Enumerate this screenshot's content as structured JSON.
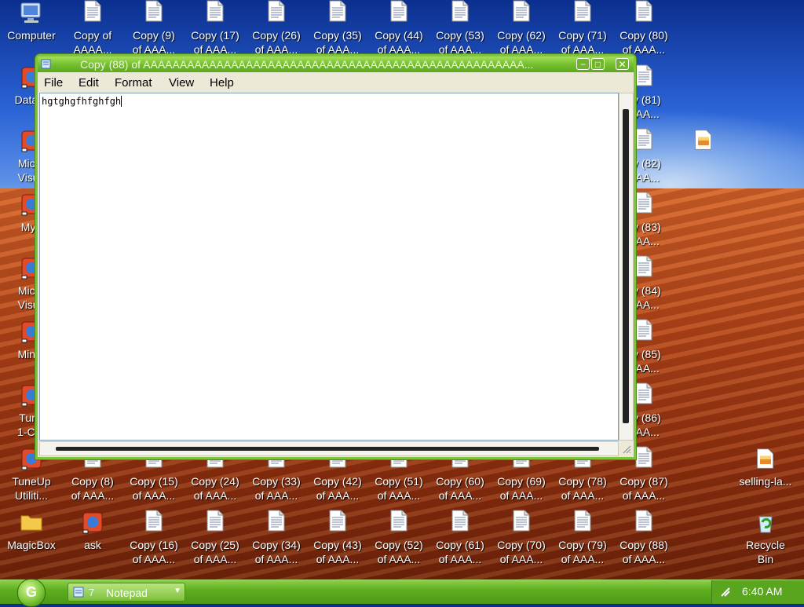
{
  "desktop": {
    "icons": [
      {
        "l1": "Computer",
        "l2": "",
        "kind": "computer"
      },
      {
        "l1": "Copy of",
        "l2": "AAAA...",
        "kind": "doc"
      },
      {
        "l1": "Copy (9)",
        "l2": "of AAA...",
        "kind": "doc"
      },
      {
        "l1": "Copy (17)",
        "l2": "of AAA...",
        "kind": "doc"
      },
      {
        "l1": "Copy (26)",
        "l2": "of AAA...",
        "kind": "doc"
      },
      {
        "l1": "Copy (35)",
        "l2": "of AAA...",
        "kind": "doc"
      },
      {
        "l1": "Copy (44)",
        "l2": "of AAA...",
        "kind": "doc"
      },
      {
        "l1": "Copy (53)",
        "l2": "of AAA...",
        "kind": "doc"
      },
      {
        "l1": "Copy (62)",
        "l2": "of AAA...",
        "kind": "doc"
      },
      {
        "l1": "Copy (71)",
        "l2": "of AAA...",
        "kind": "doc"
      },
      {
        "l1": "Copy (80)",
        "l2": "of AAA...",
        "kind": "doc"
      },
      {
        "l1": "DataW",
        "l2": "",
        "kind": "app"
      },
      {
        "l1": "py (81)",
        "l2": "AAA...",
        "kind": "doc"
      },
      {
        "l1": "Micro",
        "l2": "Visua",
        "kind": "app"
      },
      {
        "l1": "py (82)",
        "l2": "AAA...",
        "kind": "doc"
      },
      {
        "l1": "Myp",
        "l2": "",
        "kind": "app"
      },
      {
        "l1": "py (83)",
        "l2": "AAA...",
        "kind": "doc"
      },
      {
        "l1": "Micro",
        "l2": "Visua",
        "kind": "app"
      },
      {
        "l1": "py (84)",
        "l2": "AAA...",
        "kind": "doc"
      },
      {
        "l1": "MiniB",
        "l2": "",
        "kind": "app"
      },
      {
        "l1": "py (85)",
        "l2": "AAA...",
        "kind": "doc"
      },
      {
        "l1": "Tune",
        "l2": "1-Clic",
        "kind": "app"
      },
      {
        "l1": "py (86)",
        "l2": "AAA...",
        "kind": "doc"
      },
      {
        "l1": "TuneUp",
        "l2": "Utiliti...",
        "kind": "app"
      },
      {
        "l1": "Copy (8)",
        "l2": "of AAA...",
        "kind": "doc"
      },
      {
        "l1": "Copy (15)",
        "l2": "of AAA...",
        "kind": "doc"
      },
      {
        "l1": "Copy (24)",
        "l2": "of AAA...",
        "kind": "doc"
      },
      {
        "l1": "Copy (33)",
        "l2": "of AAA...",
        "kind": "doc"
      },
      {
        "l1": "Copy (42)",
        "l2": "of AAA...",
        "kind": "doc"
      },
      {
        "l1": "Copy (51)",
        "l2": "of AAA...",
        "kind": "doc"
      },
      {
        "l1": "Copy (60)",
        "l2": "of AAA...",
        "kind": "doc"
      },
      {
        "l1": "Copy (69)",
        "l2": "of AAA...",
        "kind": "doc"
      },
      {
        "l1": "Copy (78)",
        "l2": "of AAA...",
        "kind": "doc"
      },
      {
        "l1": "Copy (87)",
        "l2": "of AAA...",
        "kind": "doc"
      },
      {
        "l1": "selling-la...",
        "l2": "",
        "kind": "image"
      },
      {
        "l1": "MagicBox",
        "l2": "",
        "kind": "folder"
      },
      {
        "l1": "ask",
        "l2": "",
        "kind": "app"
      },
      {
        "l1": "Copy (16)",
        "l2": "of AAA...",
        "kind": "doc"
      },
      {
        "l1": "Copy (25)",
        "l2": "of AAA...",
        "kind": "doc"
      },
      {
        "l1": "Copy (34)",
        "l2": "of AAA...",
        "kind": "doc"
      },
      {
        "l1": "Copy (43)",
        "l2": "of AAA...",
        "kind": "doc"
      },
      {
        "l1": "Copy (52)",
        "l2": "of AAA...",
        "kind": "doc"
      },
      {
        "l1": "Copy (61)",
        "l2": "of AAA...",
        "kind": "doc"
      },
      {
        "l1": "Copy (70)",
        "l2": "of AAA...",
        "kind": "doc"
      },
      {
        "l1": "Copy (79)",
        "l2": "of AAA...",
        "kind": "doc"
      },
      {
        "l1": "Copy (88)",
        "l2": "of AAA...",
        "kind": "doc"
      },
      {
        "l1": "Recycle",
        "l2": "Bin",
        "kind": "recycle"
      }
    ],
    "floating_icon": {
      "kind": "image"
    }
  },
  "window": {
    "title": "Copy (88) of AAAAAAAAAAAAAAAAAAAAAAAAAAAAAAAAAAAAAAAAAAAAAAAAAAAA...",
    "menu": [
      "File",
      "Edit",
      "Format",
      "View",
      "Help"
    ],
    "content": "hgtghgfhfghfgh",
    "minimize_label": "−",
    "maximize_label": "□",
    "close_label": "✕"
  },
  "taskbar": {
    "start_glyph": "G",
    "task_count": "7",
    "task_label": "Notepad",
    "clock": "6:40 AM"
  },
  "colors": {
    "window_border": "#7fc43a",
    "taskbar": "#5fae20",
    "title_text": "#f3f3e0"
  }
}
